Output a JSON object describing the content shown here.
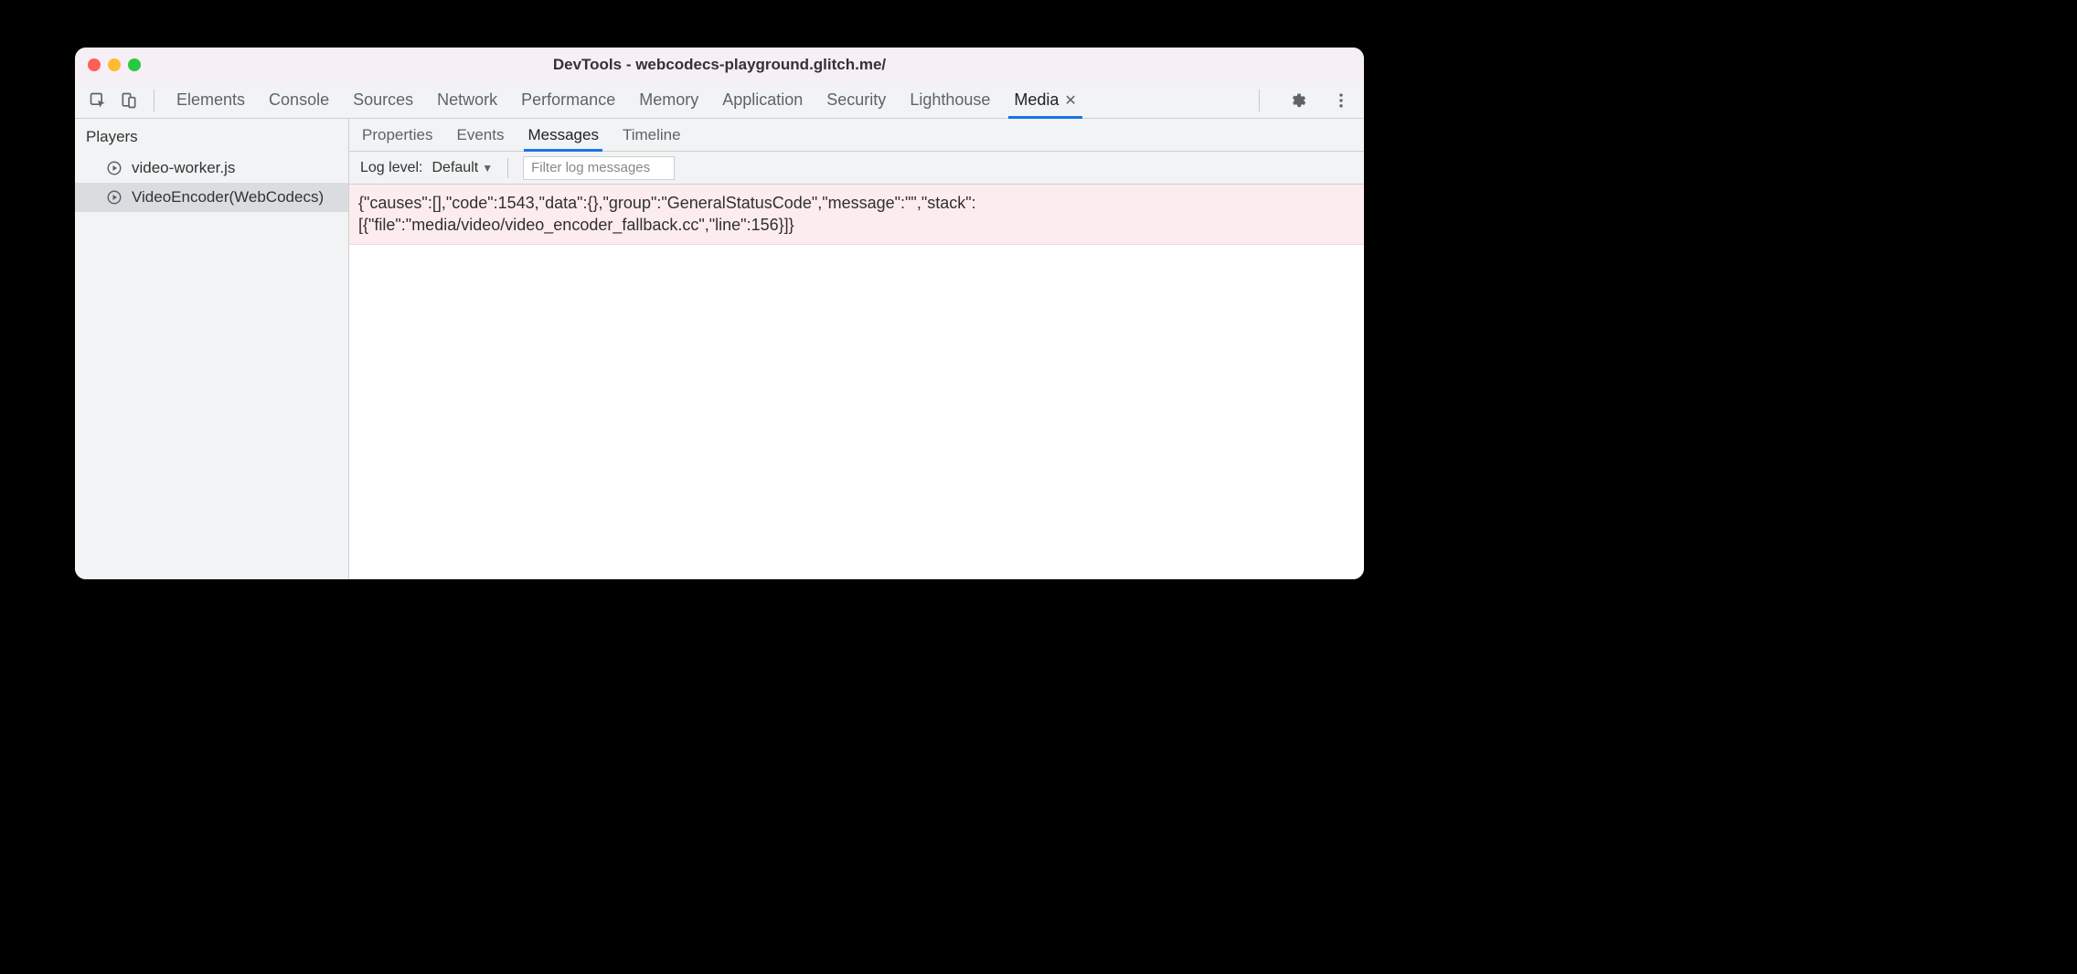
{
  "window": {
    "title": "DevTools - webcodecs-playground.glitch.me/"
  },
  "top_tabs": {
    "items": [
      {
        "label": "Elements",
        "active": false,
        "closeable": false
      },
      {
        "label": "Console",
        "active": false,
        "closeable": false
      },
      {
        "label": "Sources",
        "active": false,
        "closeable": false
      },
      {
        "label": "Network",
        "active": false,
        "closeable": false
      },
      {
        "label": "Performance",
        "active": false,
        "closeable": false
      },
      {
        "label": "Memory",
        "active": false,
        "closeable": false
      },
      {
        "label": "Application",
        "active": false,
        "closeable": false
      },
      {
        "label": "Security",
        "active": false,
        "closeable": false
      },
      {
        "label": "Lighthouse",
        "active": false,
        "closeable": false
      },
      {
        "label": "Media",
        "active": true,
        "closeable": true
      }
    ]
  },
  "sidebar": {
    "header": "Players",
    "items": [
      {
        "label": "video-worker.js",
        "selected": false
      },
      {
        "label": "VideoEncoder(WebCodecs)",
        "selected": true
      }
    ]
  },
  "subtabs": {
    "items": [
      {
        "label": "Properties",
        "active": false
      },
      {
        "label": "Events",
        "active": false
      },
      {
        "label": "Messages",
        "active": true
      },
      {
        "label": "Timeline",
        "active": false
      }
    ]
  },
  "filterbar": {
    "log_level_label": "Log level:",
    "log_level_value": "Default",
    "filter_placeholder": "Filter log messages"
  },
  "messages": [
    {
      "text": "{\"causes\":[],\"code\":1543,\"data\":{},\"group\":\"GeneralStatusCode\",\"message\":\"\",\"stack\":[{\"file\":\"media/video/video_encoder_fallback.cc\",\"line\":156}]}"
    }
  ]
}
